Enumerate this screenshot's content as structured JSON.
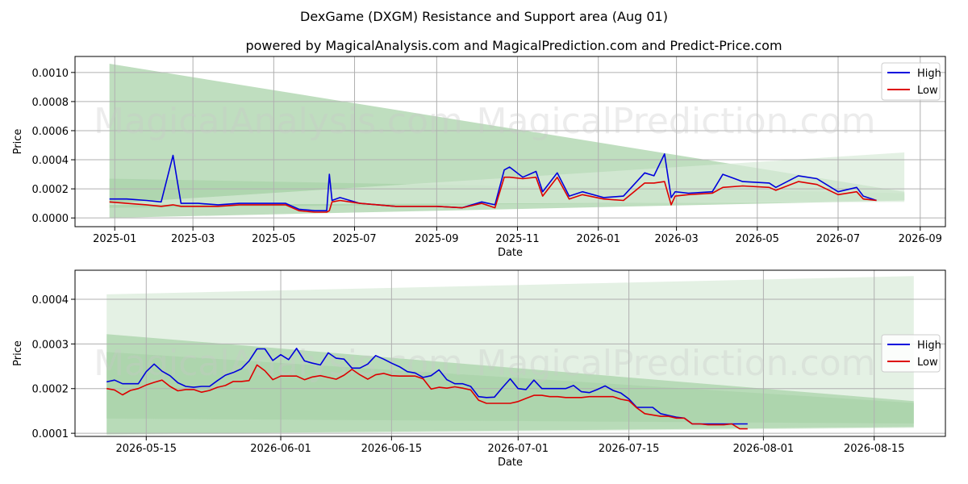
{
  "title": "DexGame (DXGM) Resistance and Support area (Aug 01)",
  "subtitle": "powered by MagicalAnalysis.com and MagicalPrediction.com and Predict-Price.com",
  "watermarks": [
    "MagicalAnalysis.com",
    "MagicalPrediction.com"
  ],
  "colors": {
    "high": "#0000dd",
    "low": "#dd0000",
    "band_dark": "#6fb56f",
    "band_light": "#a9d3a9",
    "band_pale": "#d8ebd8"
  },
  "chart_data": [
    {
      "type": "line",
      "xlabel": "Date",
      "ylabel": "Price",
      "ylim": [
        -6e-05,
        0.00111
      ],
      "x_ticks": [
        "2025-01",
        "2025-03",
        "2025-05",
        "2025-07",
        "2025-09",
        "2025-11",
        "2026-01",
        "2026-03",
        "2026-05",
        "2026-07",
        "2026-09"
      ],
      "y_ticks": [
        "0.0000",
        "0.0002",
        "0.0004",
        "0.0006",
        "0.0008",
        "0.0010"
      ],
      "grid": true,
      "legend": "top-right",
      "series": [
        {
          "name": "High",
          "x": [
            "2024-12-28",
            "2025-01-10",
            "2025-01-25",
            "2025-02-05",
            "2025-02-14",
            "2025-02-20",
            "2025-03-05",
            "2025-03-20",
            "2025-04-05",
            "2025-04-25",
            "2025-05-10",
            "2025-05-20",
            "2025-06-01",
            "2025-06-10",
            "2025-06-12",
            "2025-06-14",
            "2025-06-20",
            "2025-07-05",
            "2025-08-01",
            "2025-09-01",
            "2025-09-20",
            "2025-10-05",
            "2025-10-15",
            "2025-10-22",
            "2025-10-26",
            "2025-11-05",
            "2025-11-15",
            "2025-11-20",
            "2025-12-01",
            "2025-12-10",
            "2025-12-20",
            "2026-01-05",
            "2026-01-20",
            "2026-02-05",
            "2026-02-12",
            "2026-02-20",
            "2026-02-25",
            "2026-02-28",
            "2026-03-10",
            "2026-03-28",
            "2026-04-05",
            "2026-04-20",
            "2026-05-10",
            "2026-05-15",
            "2026-06-01",
            "2026-06-15",
            "2026-07-01",
            "2026-07-15",
            "2026-07-20",
            "2026-07-30"
          ],
          "values": [
            0.00013,
            0.00013,
            0.00012,
            0.00011,
            0.00043,
            0.0001,
            0.0001,
            9e-05,
            0.0001,
            0.0001,
            0.0001,
            6e-05,
            5e-05,
            5e-05,
            0.0003,
            0.00012,
            0.00014,
            0.0001,
            8e-05,
            8e-05,
            7e-05,
            0.00011,
            9e-05,
            0.00033,
            0.00035,
            0.00028,
            0.00032,
            0.00018,
            0.00031,
            0.00015,
            0.00018,
            0.00014,
            0.00015,
            0.00031,
            0.00029,
            0.00044,
            0.00014,
            0.00018,
            0.00017,
            0.00018,
            0.0003,
            0.00025,
            0.00024,
            0.00021,
            0.00029,
            0.00027,
            0.00018,
            0.00021,
            0.00015,
            0.00012
          ]
        },
        {
          "name": "Low",
          "x": [
            "2024-12-28",
            "2025-01-10",
            "2025-01-25",
            "2025-02-05",
            "2025-02-14",
            "2025-02-20",
            "2025-03-05",
            "2025-03-20",
            "2025-04-05",
            "2025-04-25",
            "2025-05-10",
            "2025-05-20",
            "2025-06-01",
            "2025-06-10",
            "2025-06-12",
            "2025-06-14",
            "2025-06-20",
            "2025-07-05",
            "2025-08-01",
            "2025-09-01",
            "2025-09-20",
            "2025-10-05",
            "2025-10-15",
            "2025-10-22",
            "2025-10-26",
            "2025-11-05",
            "2025-11-15",
            "2025-11-20",
            "2025-12-01",
            "2025-12-10",
            "2025-12-20",
            "2026-01-05",
            "2026-01-20",
            "2026-02-05",
            "2026-02-12",
            "2026-02-20",
            "2026-02-25",
            "2026-02-28",
            "2026-03-10",
            "2026-03-28",
            "2026-04-05",
            "2026-04-20",
            "2026-05-10",
            "2026-05-15",
            "2026-06-01",
            "2026-06-15",
            "2026-07-01",
            "2026-07-15",
            "2026-07-20",
            "2026-07-30"
          ],
          "values": [
            0.00011,
            0.0001,
            9e-05,
            8e-05,
            9e-05,
            8e-05,
            8e-05,
            8e-05,
            9e-05,
            9e-05,
            9e-05,
            5e-05,
            4e-05,
            4e-05,
            5e-05,
            0.00011,
            0.00012,
            0.0001,
            8e-05,
            8e-05,
            7e-05,
            0.0001,
            7e-05,
            0.00028,
            0.00028,
            0.00027,
            0.00028,
            0.00015,
            0.00028,
            0.00013,
            0.00016,
            0.00013,
            0.00012,
            0.00024,
            0.00024,
            0.00025,
            9e-05,
            0.00015,
            0.00016,
            0.00017,
            0.00021,
            0.00022,
            0.00021,
            0.00019,
            0.00025,
            0.00023,
            0.00016,
            0.00018,
            0.00013,
            0.00012
          ]
        }
      ],
      "bands": [
        {
          "x": [
            "2024-12-28",
            "2026-08-20"
          ],
          "upper": [
            0.00106,
            0.00018
          ],
          "lower": [
            0.0,
            0.00012
          ],
          "tone": "light"
        },
        {
          "x": [
            "2024-12-28",
            "2026-08-20"
          ],
          "upper": [
            0.00027,
            0.00017
          ],
          "lower": [
            7e-05,
            0.00012
          ],
          "tone": "light"
        },
        {
          "x": [
            "2024-12-28",
            "2026-08-20"
          ],
          "upper": [
            0.0001,
            0.00045
          ],
          "lower": [
            9e-05,
            0.00011
          ],
          "tone": "pale"
        }
      ]
    },
    {
      "type": "line",
      "xlabel": "Date",
      "ylabel": "Price",
      "ylim": [
        9.3e-05,
        0.000465
      ],
      "x_ticks": [
        "2026-05-15",
        "2026-06-01",
        "2026-06-15",
        "2026-07-01",
        "2026-07-15",
        "2026-08-01",
        "2026-08-15"
      ],
      "y_ticks": [
        "0.0001",
        "0.0002",
        "0.0003",
        "0.0004"
      ],
      "grid": true,
      "legend": "center-right",
      "series": [
        {
          "name": "High",
          "x": [
            "2026-05-10",
            "2026-05-11",
            "2026-05-12",
            "2026-05-13",
            "2026-05-14",
            "2026-05-15",
            "2026-05-16",
            "2026-05-17",
            "2026-05-18",
            "2026-05-19",
            "2026-05-20",
            "2026-05-21",
            "2026-05-22",
            "2026-05-23",
            "2026-05-24",
            "2026-05-25",
            "2026-05-26",
            "2026-05-27",
            "2026-05-28",
            "2026-05-29",
            "2026-05-30",
            "2026-05-31",
            "2026-06-01",
            "2026-06-02",
            "2026-06-03",
            "2026-06-04",
            "2026-06-05",
            "2026-06-06",
            "2026-06-07",
            "2026-06-08",
            "2026-06-09",
            "2026-06-10",
            "2026-06-11",
            "2026-06-12",
            "2026-06-13",
            "2026-06-14",
            "2026-06-15",
            "2026-06-16",
            "2026-06-17",
            "2026-06-18",
            "2026-06-19",
            "2026-06-20",
            "2026-06-21",
            "2026-06-22",
            "2026-06-23",
            "2026-06-24",
            "2026-06-25",
            "2026-06-26",
            "2026-06-27",
            "2026-06-28",
            "2026-06-29",
            "2026-06-30",
            "2026-07-01",
            "2026-07-02",
            "2026-07-03",
            "2026-07-04",
            "2026-07-05",
            "2026-07-06",
            "2026-07-07",
            "2026-07-08",
            "2026-07-09",
            "2026-07-10",
            "2026-07-11",
            "2026-07-12",
            "2026-07-13",
            "2026-07-14",
            "2026-07-15",
            "2026-07-16",
            "2026-07-17",
            "2026-07-18",
            "2026-07-19",
            "2026-07-20",
            "2026-07-21",
            "2026-07-22",
            "2026-07-23",
            "2026-07-24",
            "2026-07-25",
            "2026-07-26",
            "2026-07-27",
            "2026-07-28",
            "2026-07-29",
            "2026-07-30"
          ],
          "values": [
            0.000215,
            0.000219,
            0.000211,
            0.000211,
            0.000211,
            0.000238,
            0.000255,
            0.000239,
            0.000229,
            0.000213,
            0.000205,
            0.000203,
            0.000205,
            0.000205,
            0.000218,
            0.00023,
            0.000236,
            0.000244,
            0.000262,
            0.000289,
            0.000289,
            0.000263,
            0.000276,
            0.000265,
            0.00029,
            0.000262,
            0.000257,
            0.000253,
            0.00028,
            0.000268,
            0.000266,
            0.000246,
            0.000246,
            0.000255,
            0.000274,
            0.000266,
            0.000257,
            0.000249,
            0.000238,
            0.000235,
            0.000225,
            0.000229,
            0.000242,
            0.00022,
            0.000211,
            0.000211,
            0.000205,
            0.000182,
            0.00018,
            0.000181,
            0.000202,
            0.000222,
            0.0002,
            0.000198,
            0.000219,
            0.0002,
            0.0002,
            0.0002,
            0.0002,
            0.000207,
            0.000193,
            0.000191,
            0.000198,
            0.000206,
            0.000196,
            0.00019,
            0.000177,
            0.000158,
            0.000158,
            0.000158,
            0.000144,
            0.00014,
            0.000136,
            0.000134,
            0.000121,
            0.000121,
            0.000121,
            0.000121,
            0.000121,
            0.000121,
            0.000121,
            0.000121
          ]
        },
        {
          "name": "Low",
          "x": [
            "2026-05-10",
            "2026-05-11",
            "2026-05-12",
            "2026-05-13",
            "2026-05-14",
            "2026-05-15",
            "2026-05-16",
            "2026-05-17",
            "2026-05-18",
            "2026-05-19",
            "2026-05-20",
            "2026-05-21",
            "2026-05-22",
            "2026-05-23",
            "2026-05-24",
            "2026-05-25",
            "2026-05-26",
            "2026-05-27",
            "2026-05-28",
            "2026-05-29",
            "2026-05-30",
            "2026-05-31",
            "2026-06-01",
            "2026-06-02",
            "2026-06-03",
            "2026-06-04",
            "2026-06-05",
            "2026-06-06",
            "2026-06-07",
            "2026-06-08",
            "2026-06-09",
            "2026-06-10",
            "2026-06-11",
            "2026-06-12",
            "2026-06-13",
            "2026-06-14",
            "2026-06-15",
            "2026-06-16",
            "2026-06-17",
            "2026-06-18",
            "2026-06-19",
            "2026-06-20",
            "2026-06-21",
            "2026-06-22",
            "2026-06-23",
            "2026-06-24",
            "2026-06-25",
            "2026-06-26",
            "2026-06-27",
            "2026-06-28",
            "2026-06-29",
            "2026-06-30",
            "2026-07-01",
            "2026-07-02",
            "2026-07-03",
            "2026-07-04",
            "2026-07-05",
            "2026-07-06",
            "2026-07-07",
            "2026-07-08",
            "2026-07-09",
            "2026-07-10",
            "2026-07-11",
            "2026-07-12",
            "2026-07-13",
            "2026-07-14",
            "2026-07-15",
            "2026-07-16",
            "2026-07-17",
            "2026-07-18",
            "2026-07-19",
            "2026-07-20",
            "2026-07-21",
            "2026-07-22",
            "2026-07-23",
            "2026-07-24",
            "2026-07-25",
            "2026-07-26",
            "2026-07-27",
            "2026-07-28",
            "2026-07-29",
            "2026-07-30"
          ],
          "values": [
            0.0002,
            0.000197,
            0.000186,
            0.000196,
            0.0002,
            0.000208,
            0.000214,
            0.000219,
            0.000205,
            0.000195,
            0.000198,
            0.000198,
            0.000192,
            0.000196,
            0.000203,
            0.000207,
            0.000216,
            0.000216,
            0.000218,
            0.000253,
            0.00024,
            0.00022,
            0.000228,
            0.000228,
            0.000228,
            0.00022,
            0.000226,
            0.000229,
            0.000225,
            0.000221,
            0.00023,
            0.000243,
            0.000231,
            0.000221,
            0.000231,
            0.000234,
            0.000229,
            0.000228,
            0.000228,
            0.000228,
            0.000222,
            0.000199,
            0.000203,
            0.000201,
            0.000204,
            0.000201,
            0.000197,
            0.000174,
            0.000167,
            0.000167,
            0.000167,
            0.000167,
            0.000171,
            0.000178,
            0.000185,
            0.000185,
            0.000182,
            0.000182,
            0.00018,
            0.00018,
            0.00018,
            0.000182,
            0.000182,
            0.000182,
            0.000182,
            0.000176,
            0.000173,
            0.000157,
            0.000144,
            0.000141,
            0.000138,
            0.000138,
            0.000134,
            0.000134,
            0.000121,
            0.000121,
            0.000119,
            0.000119,
            0.000119,
            0.000121,
            0.00011,
            0.00011
          ]
        }
      ],
      "bands": [
        {
          "x": [
            "2026-05-10",
            "2026-08-20"
          ],
          "upper": [
            0.000411,
            0.000452
          ],
          "lower": [
            9.6e-05,
            0.000112
          ],
          "tone": "pale"
        },
        {
          "x": [
            "2026-05-10",
            "2026-08-20"
          ],
          "upper": [
            0.000322,
            0.000172
          ],
          "lower": [
            9.8e-05,
            0.000114
          ],
          "tone": "light"
        },
        {
          "x": [
            "2026-05-10",
            "2026-08-20"
          ],
          "upper": [
            0.000282,
            0.000168
          ],
          "lower": [
            0.000133,
            0.000122
          ],
          "tone": "light"
        }
      ]
    }
  ]
}
